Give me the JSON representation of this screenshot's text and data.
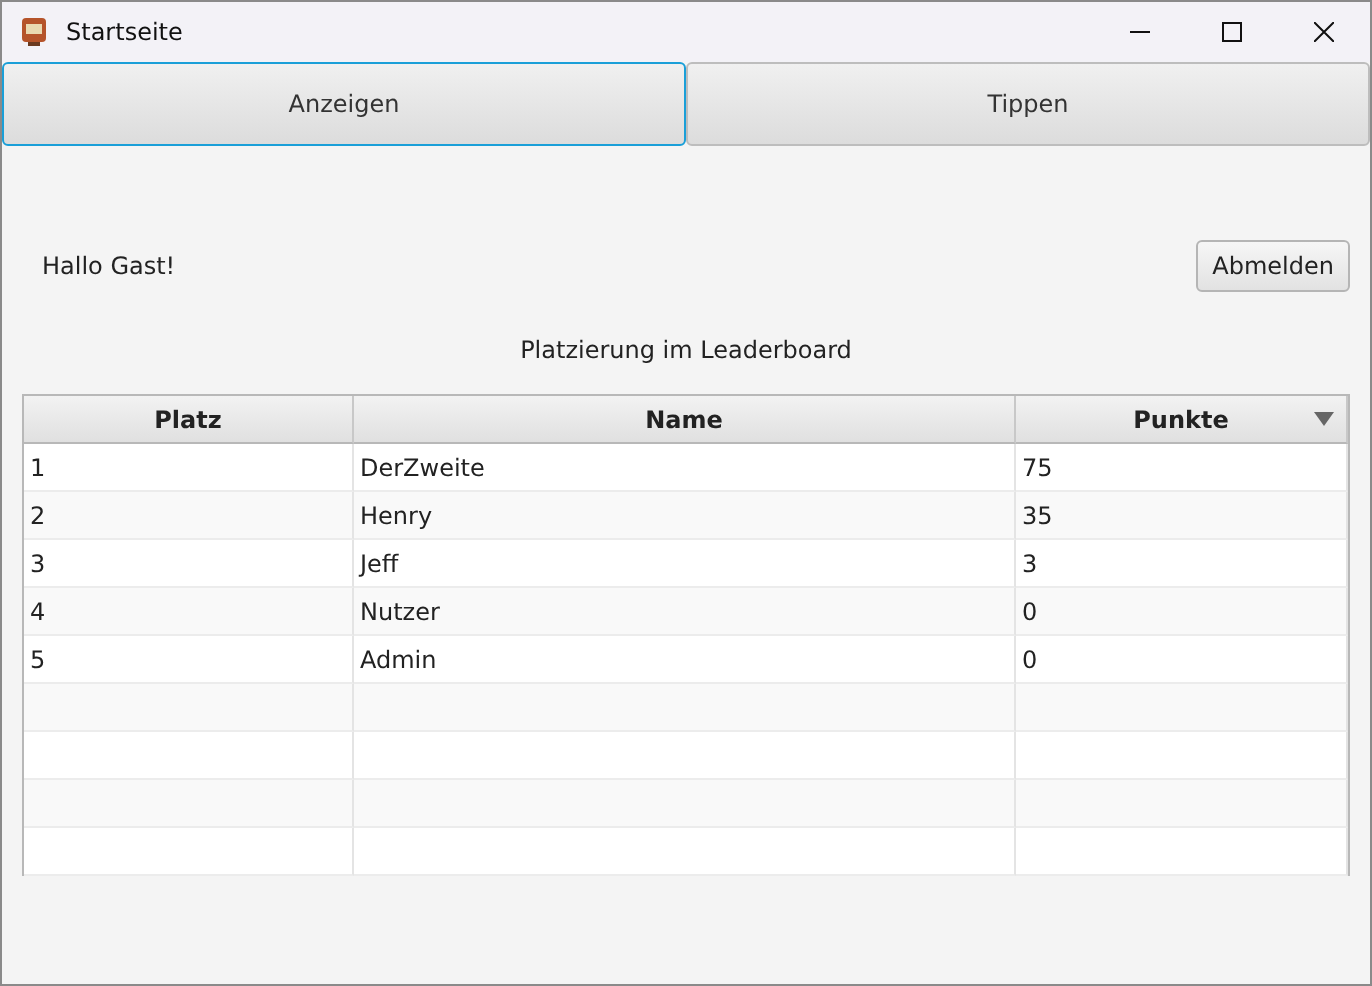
{
  "window": {
    "title": "Startseite"
  },
  "tabs": [
    {
      "label": "Anzeigen",
      "selected": true
    },
    {
      "label": "Tippen",
      "selected": false
    }
  ],
  "greeting": "Hallo Gast!",
  "logout_button": "Abmelden",
  "caption": "Platzierung im Leaderboard",
  "table": {
    "columns": [
      {
        "label": "Platz",
        "sorted": false
      },
      {
        "label": "Name",
        "sorted": false
      },
      {
        "label": "Punkte",
        "sorted": true
      }
    ],
    "rows": [
      [
        "1",
        "DerZweite",
        "75"
      ],
      [
        "2",
        "Henry",
        "35"
      ],
      [
        "3",
        "Jeff",
        "3"
      ],
      [
        "4",
        "Nutzer",
        "0"
      ],
      [
        "5",
        "Admin",
        "0"
      ]
    ]
  }
}
